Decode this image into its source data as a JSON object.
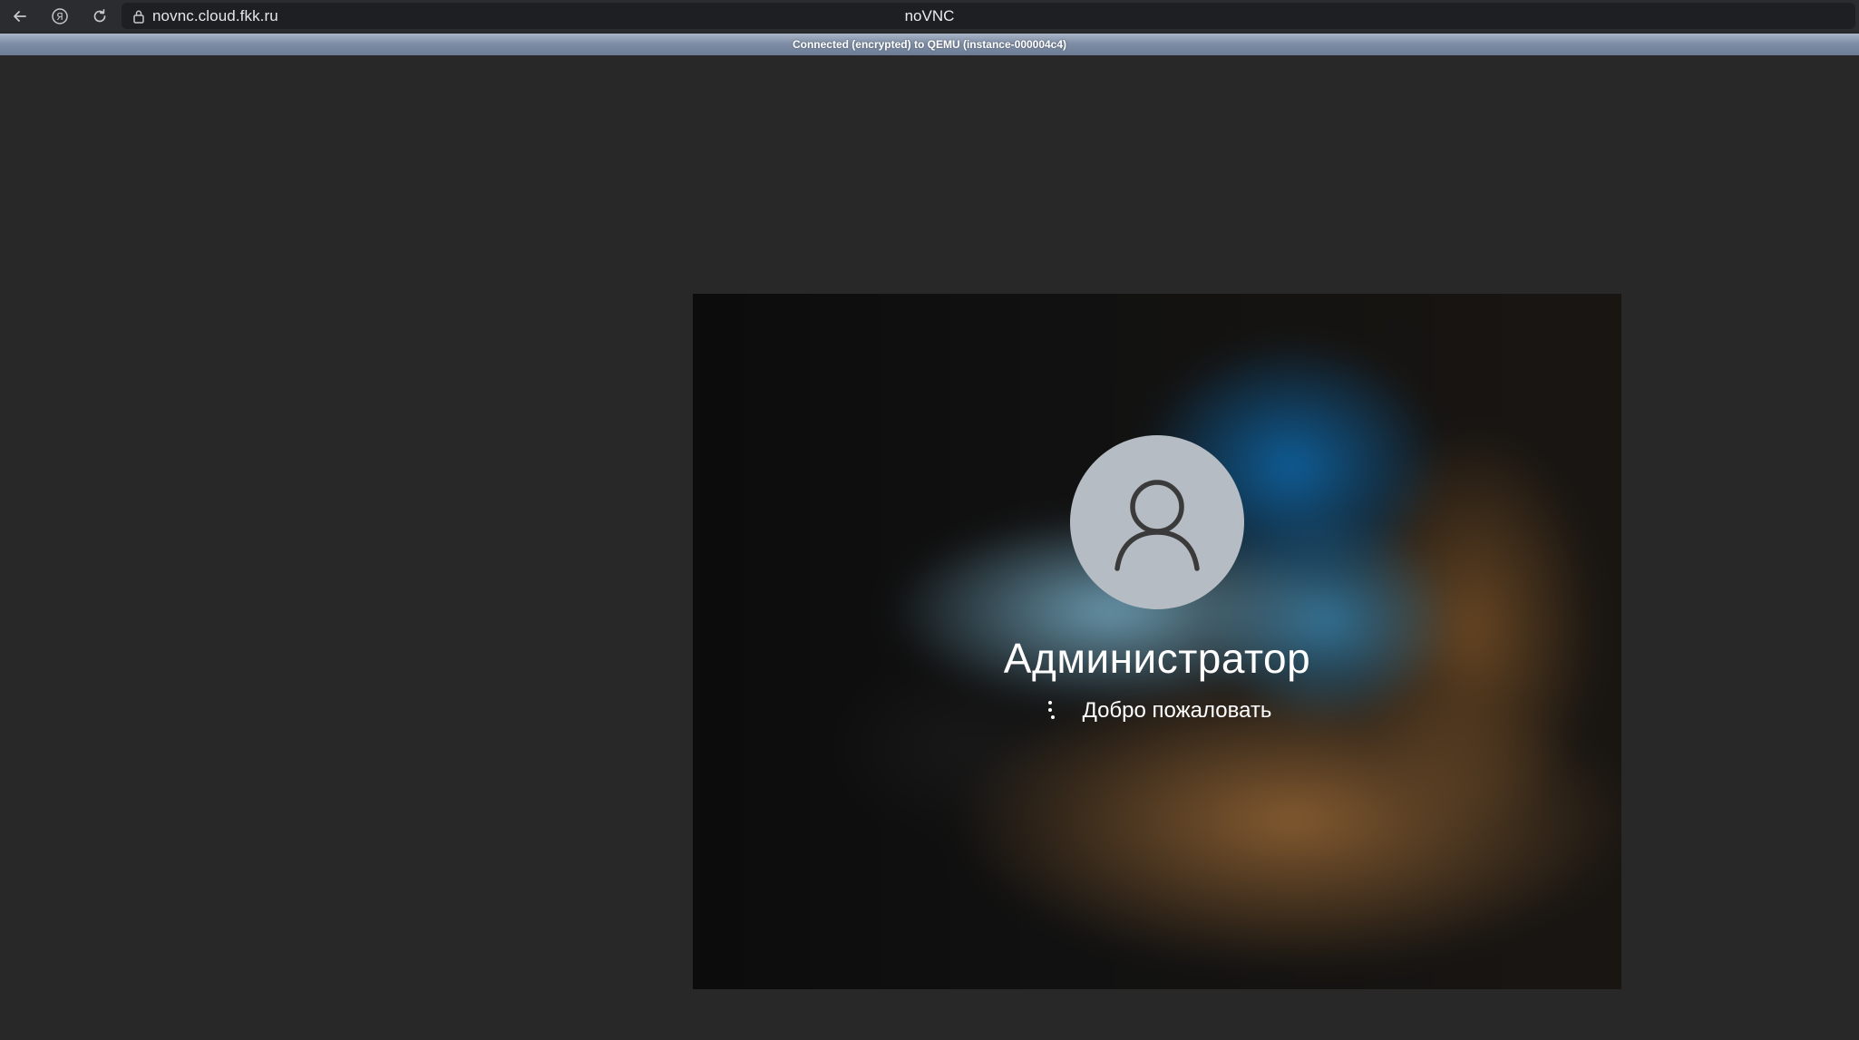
{
  "browser": {
    "url": "novnc.cloud.fkk.ru",
    "title": "noVNC"
  },
  "status": {
    "text": "Connected (encrypted) to QEMU (instance-000004c4)"
  },
  "login": {
    "username": "Администратор",
    "message": "Добро пожаловать"
  },
  "colors": {
    "status_strip": "#7f8ea6",
    "page_background": "#282828",
    "avatar_circle": "#b5bcc4"
  },
  "icons": [
    "back-arrow-icon",
    "yandex-icon",
    "reload-icon",
    "lock-icon",
    "user-silhouette-icon",
    "loading-spinner-icon"
  ]
}
